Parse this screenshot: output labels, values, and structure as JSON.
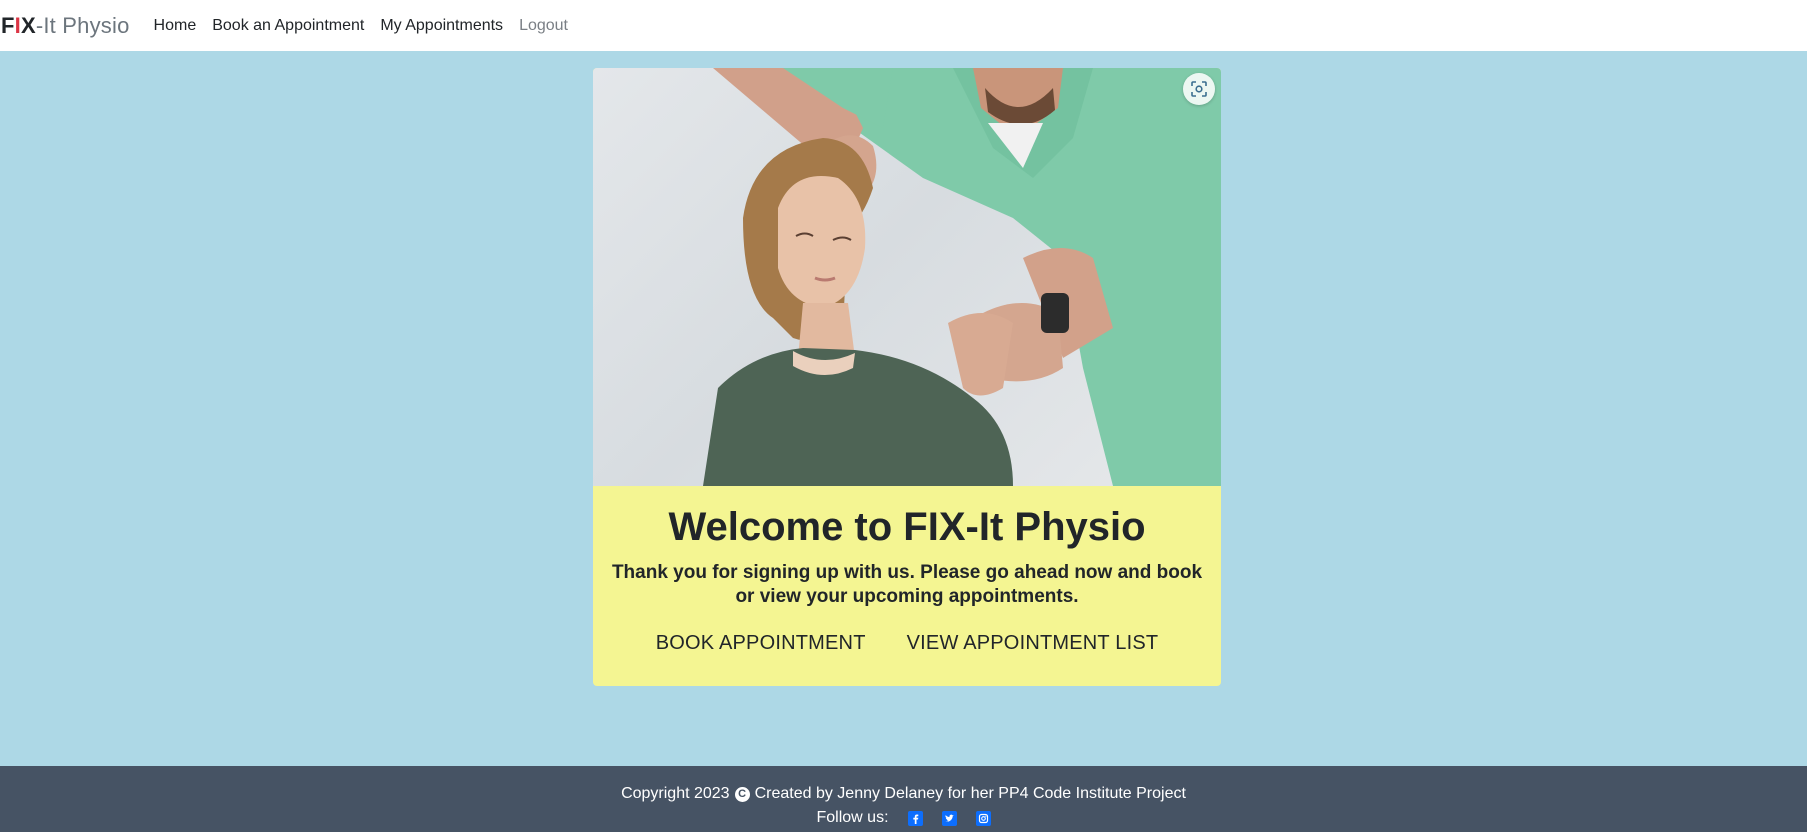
{
  "nav": {
    "brand_1": "F",
    "brand_2": "I",
    "brand_3": "X",
    "brand_4": "-It Physio",
    "links": [
      "Home",
      "Book an Appointment",
      "My Appointments",
      "Logout"
    ]
  },
  "hero": {
    "scan_icon": "visual-search-icon"
  },
  "card": {
    "title": "Welcome to FIX-It Physio",
    "text": "Thank you for signing up with us. Please go ahead now and book or view your upcoming appointments.",
    "buttons": [
      "BOOK APPOINTMENT",
      "VIEW APPOINTMENT LIST"
    ]
  },
  "footer": {
    "copyright_prefix": "Copyright 2023",
    "copyright_suffix": "Created by Jenny Delaney for her PP4 Code Institute Project",
    "copyright_icon": "C",
    "follow_label": "Follow us:",
    "social_icons": [
      "facebook-icon",
      "twitter-icon",
      "instagram-icon"
    ]
  },
  "colors": {
    "background": "#add8e6",
    "card": "#f4f592",
    "footer": "#465364",
    "brand_accent": "#dc3545",
    "social": "#0d6efd"
  }
}
